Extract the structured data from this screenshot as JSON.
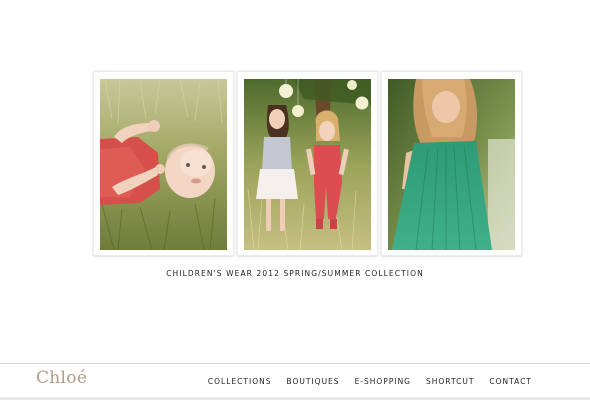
{
  "gallery": {
    "photos": [
      {
        "icon": "baby-in-red-lying-in-grass-photo"
      },
      {
        "icon": "two-girls-in-meadow-with-lanterns-photo"
      },
      {
        "icon": "girl-in-green-dress-photo"
      }
    ],
    "caption": "CHILDREN'S WEAR 2012 SPRING/SUMMER COLLECTION"
  },
  "footer": {
    "logo": "Chloé",
    "nav": [
      {
        "label": "COLLECTIONS"
      },
      {
        "label": "BOUTIQUES"
      },
      {
        "label": "E-SHOPPING"
      },
      {
        "label": "SHORTCUT"
      },
      {
        "label": "CONTACT"
      }
    ]
  },
  "colors": {
    "background": "#ffffff",
    "logo": "#b29a85",
    "text": "#222222",
    "divider": "#d4d4d4"
  }
}
